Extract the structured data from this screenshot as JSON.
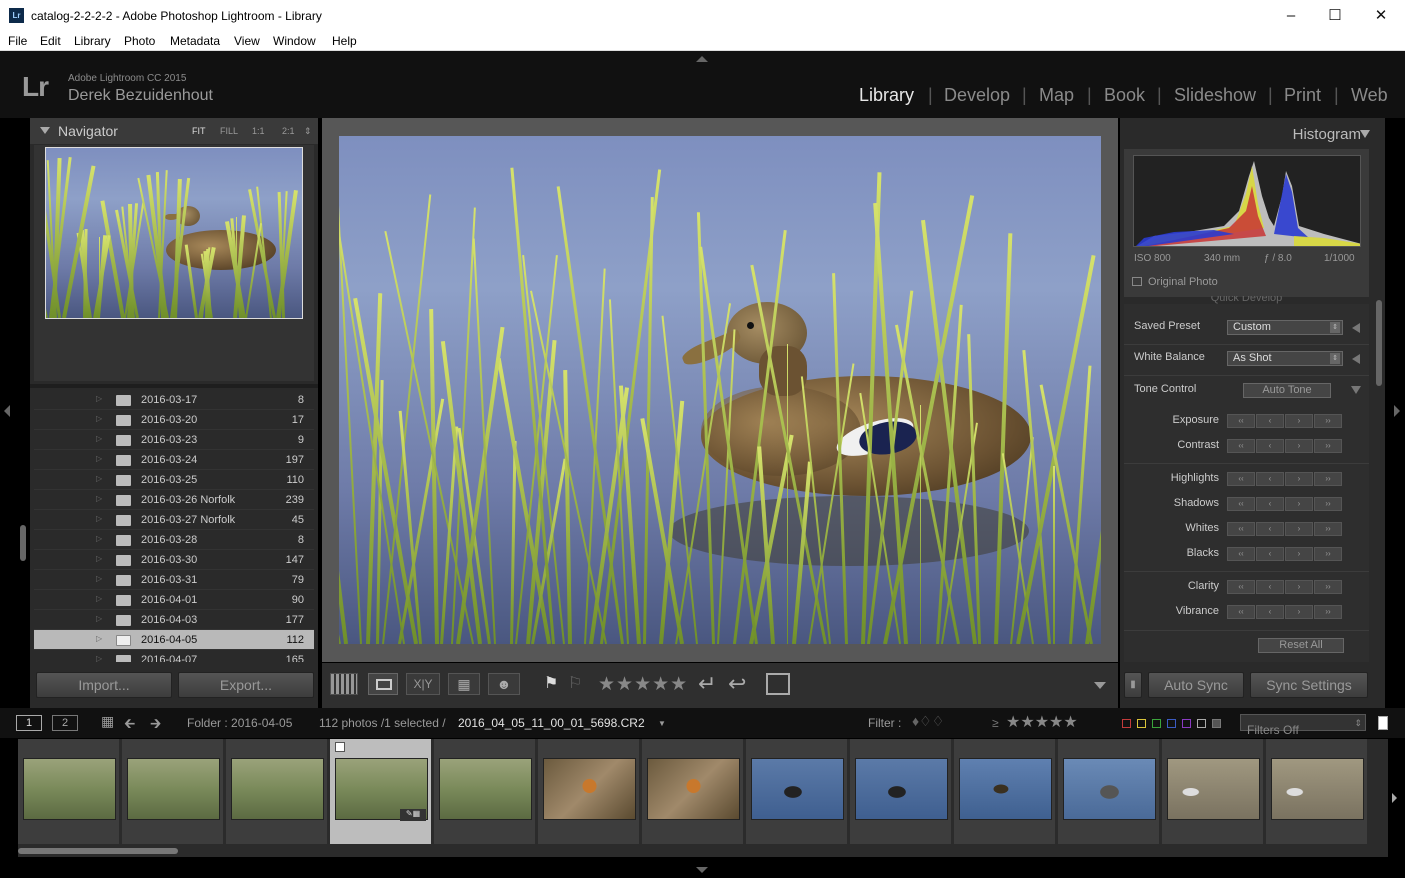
{
  "window": {
    "title": "catalog-2-2-2-2 - Adobe Photoshop Lightroom - Library",
    "app_icon": "Lr",
    "controls": [
      "minimize",
      "maximize",
      "close"
    ]
  },
  "menu": [
    "File",
    "Edit",
    "Library",
    "Photo",
    "Metadata",
    "View",
    "Window",
    "Help"
  ],
  "identity": {
    "logo": "Lr",
    "product": "Adobe Lightroom CC 2015",
    "user": "Derek Bezuidenhout"
  },
  "modules": [
    "Library",
    "Develop",
    "Map",
    "Book",
    "Slideshow",
    "Print",
    "Web"
  ],
  "active_module": "Library",
  "navigator": {
    "title": "Navigator",
    "zoom_options": [
      "FIT",
      "FILL",
      "1:1",
      "2:1"
    ],
    "selected_zoom": "FIT"
  },
  "folders": [
    {
      "name": "2016-03-17",
      "count": "8"
    },
    {
      "name": "2016-03-20",
      "count": "17"
    },
    {
      "name": "2016-03-23",
      "count": "9"
    },
    {
      "name": "2016-03-24",
      "count": "197"
    },
    {
      "name": "2016-03-25",
      "count": "110"
    },
    {
      "name": "2016-03-26 Norfolk",
      "count": "239"
    },
    {
      "name": "2016-03-27 Norfolk",
      "count": "45"
    },
    {
      "name": "2016-03-28",
      "count": "8"
    },
    {
      "name": "2016-03-30",
      "count": "147"
    },
    {
      "name": "2016-03-31",
      "count": "79"
    },
    {
      "name": "2016-04-01",
      "count": "90"
    },
    {
      "name": "2016-04-03",
      "count": "177"
    },
    {
      "name": "2016-04-05",
      "count": "112",
      "selected": true
    },
    {
      "name": "2016-04-07",
      "count": "165"
    }
  ],
  "buttons": {
    "import": "Import...",
    "export": "Export..."
  },
  "histogram": {
    "title": "Histogram",
    "iso": "ISO 800",
    "focal": "340 mm",
    "aperture": "ƒ / 8.0",
    "shutter": "1/1000",
    "original_photo": "Original Photo"
  },
  "quick_develop": {
    "header_fragment": "Quick Develop",
    "saved_preset_label": "Saved Preset",
    "saved_preset_value": "Custom",
    "white_balance_label": "White Balance",
    "white_balance_value": "As Shot",
    "tone_control_label": "Tone Control",
    "auto_tone": "Auto Tone",
    "sliders": [
      "Exposure",
      "Contrast",
      "Highlights",
      "Shadows",
      "Whites",
      "Blacks",
      "Clarity",
      "Vibrance"
    ],
    "reset_all": "Reset All",
    "step_glyphs": [
      "‹‹",
      "‹",
      "›",
      "››"
    ]
  },
  "sync": {
    "auto_sync": "Auto Sync",
    "sync_settings": "Sync Settings"
  },
  "filmstrip_bar": {
    "screen1": "1",
    "screen2": "2",
    "folder": "Folder : 2016-04-05",
    "count": "112 photos /1 selected /",
    "filename": "2016_04_05_11_00_01_5698.CR2",
    "filter_label": "Filter :",
    "rating_op": "≥",
    "filters_value": "Filters Off"
  },
  "filmstrip": {
    "thumbs": [
      "duck",
      "duck",
      "duck",
      "duck",
      "duck",
      "butterfly",
      "butterfly",
      "coot",
      "coot",
      "duck-diving",
      "duck-swim",
      "bird-water",
      "bird-water"
    ],
    "selected_index": 3
  },
  "colors": {
    "accent": "#dcdcdc",
    "panel": "#2a2a2a",
    "chrome": "#111111",
    "label_red": "#c23b3b",
    "label_yellow": "#d9c43a",
    "label_green": "#3ba43b",
    "label_blue": "#3b5bc2",
    "label_purple": "#8a3bc2"
  }
}
